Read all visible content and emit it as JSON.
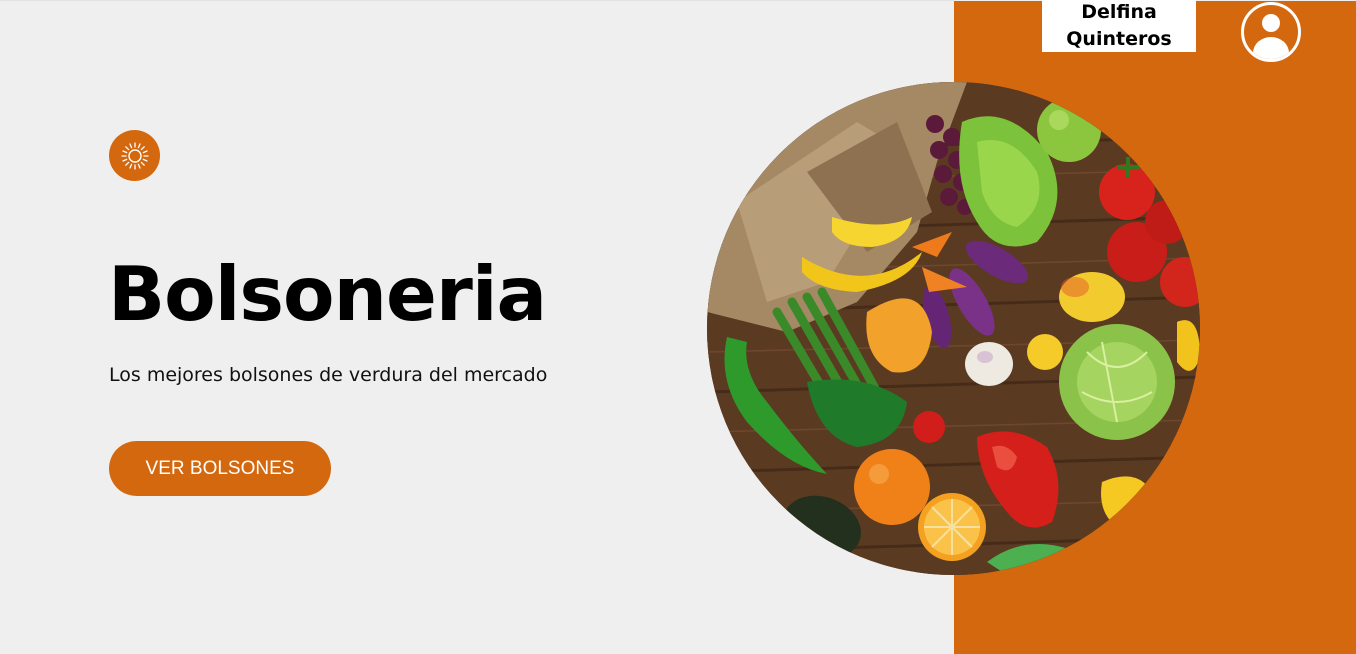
{
  "header": {
    "user_name_line1": "Delfina",
    "user_name_line2": "Quinteros",
    "avatar_icon": "user-circle-icon"
  },
  "hero": {
    "badge_icon": "sun-icon",
    "title": "Bolsoneria",
    "subtitle": "Los mejores bolsones de verdura del mercado",
    "cta_label": "VER BOLSONES",
    "image_icon": "vegetables-photo"
  },
  "colors": {
    "accent": "#d4680e",
    "background": "#efefef",
    "text": "#000000",
    "button_text": "#ffffff"
  }
}
